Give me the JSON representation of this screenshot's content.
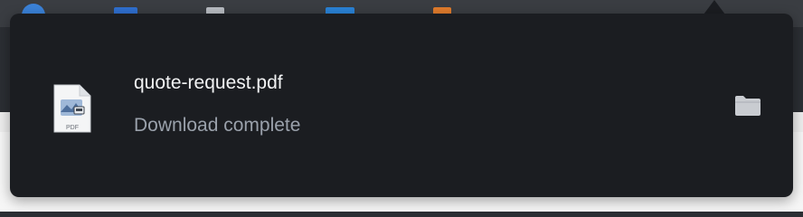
{
  "download": {
    "file_name": "quote-request.pdf",
    "status": "Download complete",
    "file_type_label": "PDF",
    "file_icon": "pdf-file-icon",
    "action_icon": "folder-icon"
  },
  "colors": {
    "popover_bg": "#1b1d21",
    "file_name": "#f2f3f4",
    "status_text": "#9aa1ab",
    "folder_icon": "#c9ccd1"
  }
}
